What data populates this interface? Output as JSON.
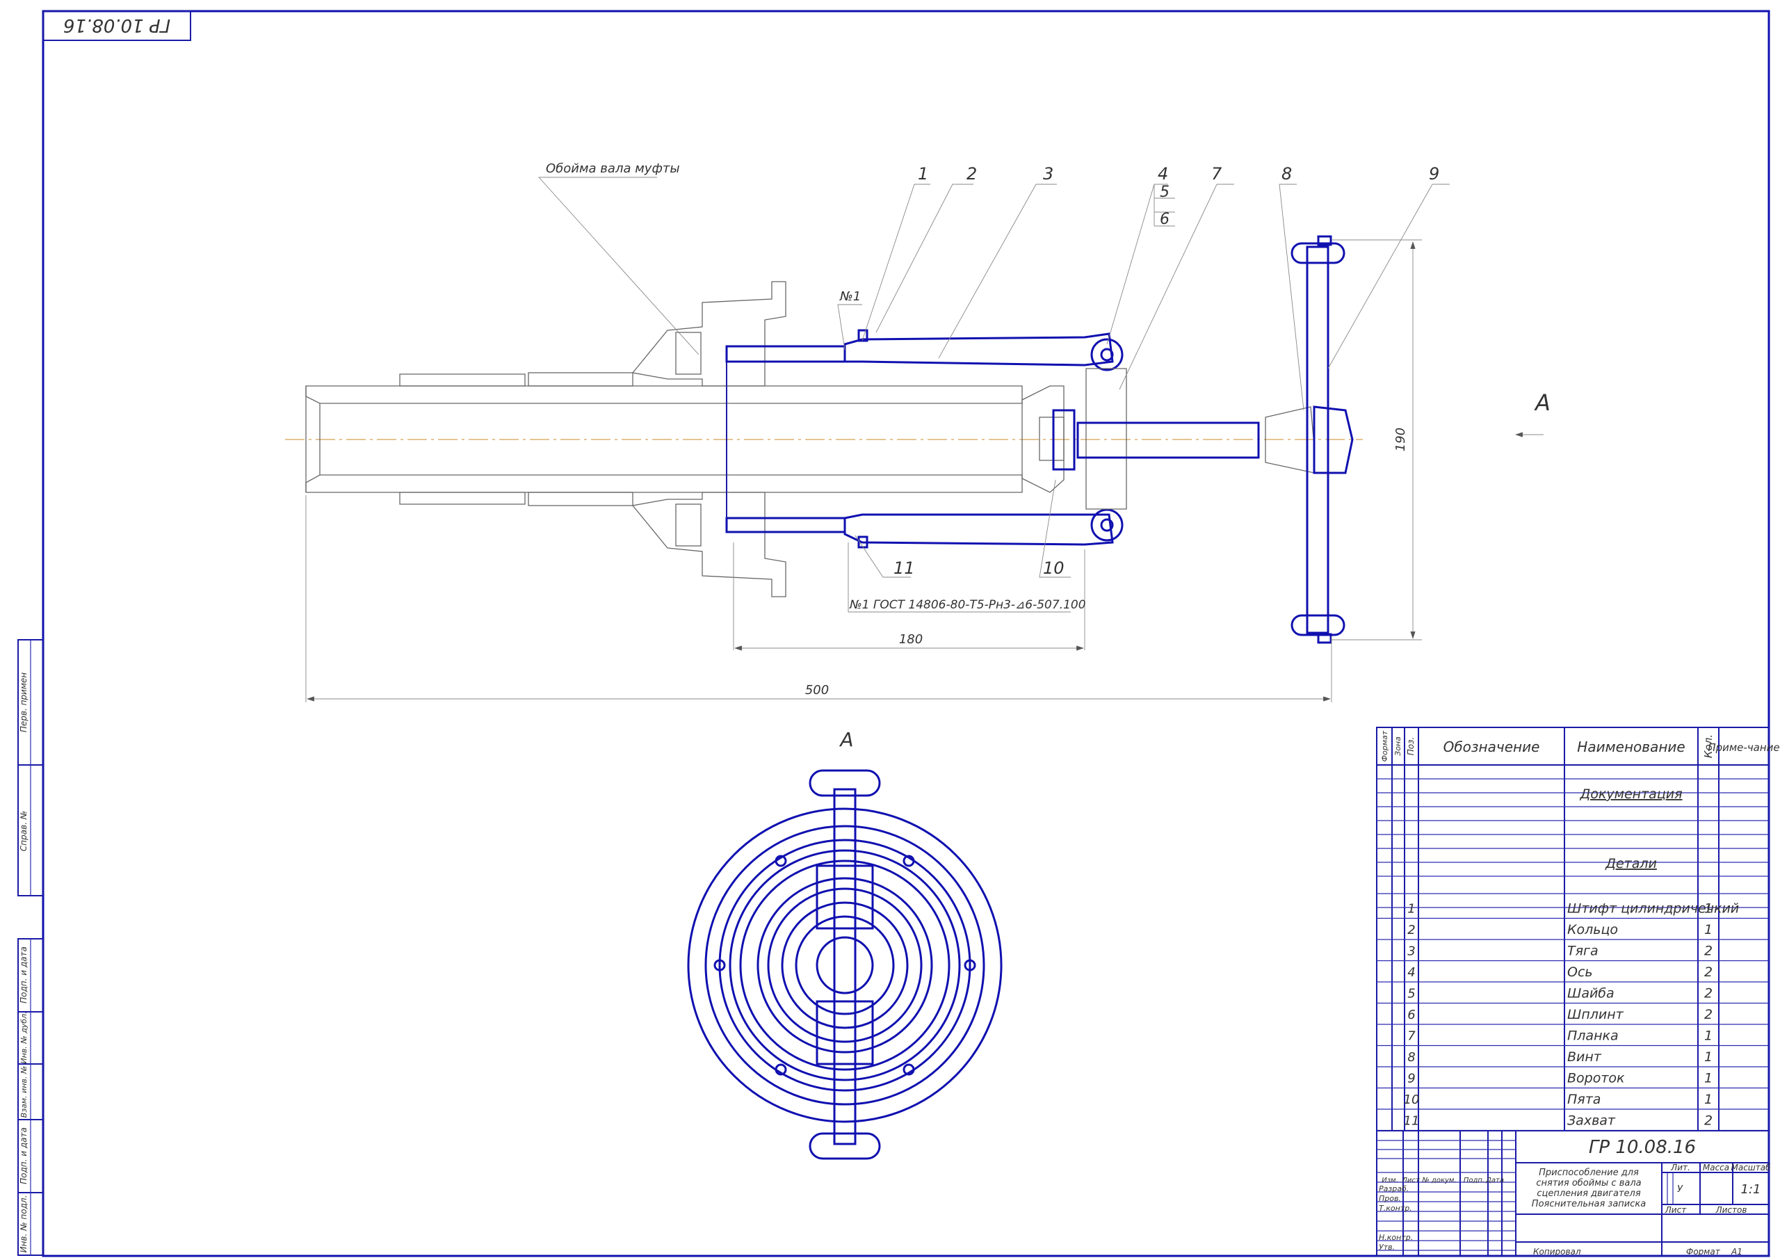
{
  "corner_stamp": "ГР 10.08.16",
  "callouts": {
    "shaft_label": "Обойма вала муфты",
    "numbers": [
      "1",
      "2",
      "3",
      "4",
      "5",
      "6",
      "7",
      "8",
      "9",
      "10",
      "11"
    ],
    "pin_mark": "№1",
    "gost_note": "№1 ГОСТ 14806-80-Т5-Рн3-⊿6-50⁠7.100",
    "view_arrow": "А",
    "view_title": "А"
  },
  "dimensions": {
    "d180": "180",
    "d500": "500",
    "d190": "190"
  },
  "side_boxes": [
    "Перв. примен",
    "Справ. №",
    "Подп. и дата",
    "Инв. № дубл.",
    "Взам. инв. №",
    "Подп. и дата",
    "Инв. № подл."
  ],
  "spec_table": {
    "headers": {
      "format": "Формат",
      "zone": "Зона",
      "pos": "Поз.",
      "designation": "Обозначение",
      "name": "Наименование",
      "qty": "Кол.",
      "note": "Приме-чание"
    },
    "sections": {
      "docs": "Документация",
      "parts": "Детали"
    },
    "rows": [
      {
        "pos": "1",
        "name": "Штифт цилиндричечкий",
        "qty": "1"
      },
      {
        "pos": "2",
        "name": "Кольцо",
        "qty": "1"
      },
      {
        "pos": "3",
        "name": "Тяга",
        "qty": "2"
      },
      {
        "pos": "4",
        "name": "Ось",
        "qty": "2"
      },
      {
        "pos": "5",
        "name": "Шайба",
        "qty": "2"
      },
      {
        "pos": "6",
        "name": "Шплинт",
        "qty": "2"
      },
      {
        "pos": "7",
        "name": "Планка",
        "qty": "1"
      },
      {
        "pos": "8",
        "name": "Винт",
        "qty": "1"
      },
      {
        "pos": "9",
        "name": "Вороток",
        "qty": "1"
      },
      {
        "pos": "10",
        "name": "Пята",
        "qty": "1"
      },
      {
        "pos": "11",
        "name": "Захват",
        "qty": "2"
      }
    ]
  },
  "title_block": {
    "code": "ГР 10.08.16",
    "title_line1": "Приспособление для",
    "title_line2": "снятия обоймы с вала",
    "title_line3": "сцепления двигателя",
    "title_line4": "Пояснительная записка",
    "lit": "Лит.",
    "mass": "Масса",
    "scale": "Масштаб",
    "lit_value": "У",
    "scale_value": "1:1",
    "sheet": "Лист",
    "sheets": "Листов",
    "cols": [
      "Изм.",
      "Лист",
      "№ докум.",
      "Подп.",
      "Дата"
    ],
    "roles": [
      "Разраб.",
      "Пров.",
      "Т.контр.",
      "",
      "Н.контр.",
      "Утв."
    ],
    "copied": "Копировал",
    "format_label": "Формат",
    "format_value": "А1"
  }
}
